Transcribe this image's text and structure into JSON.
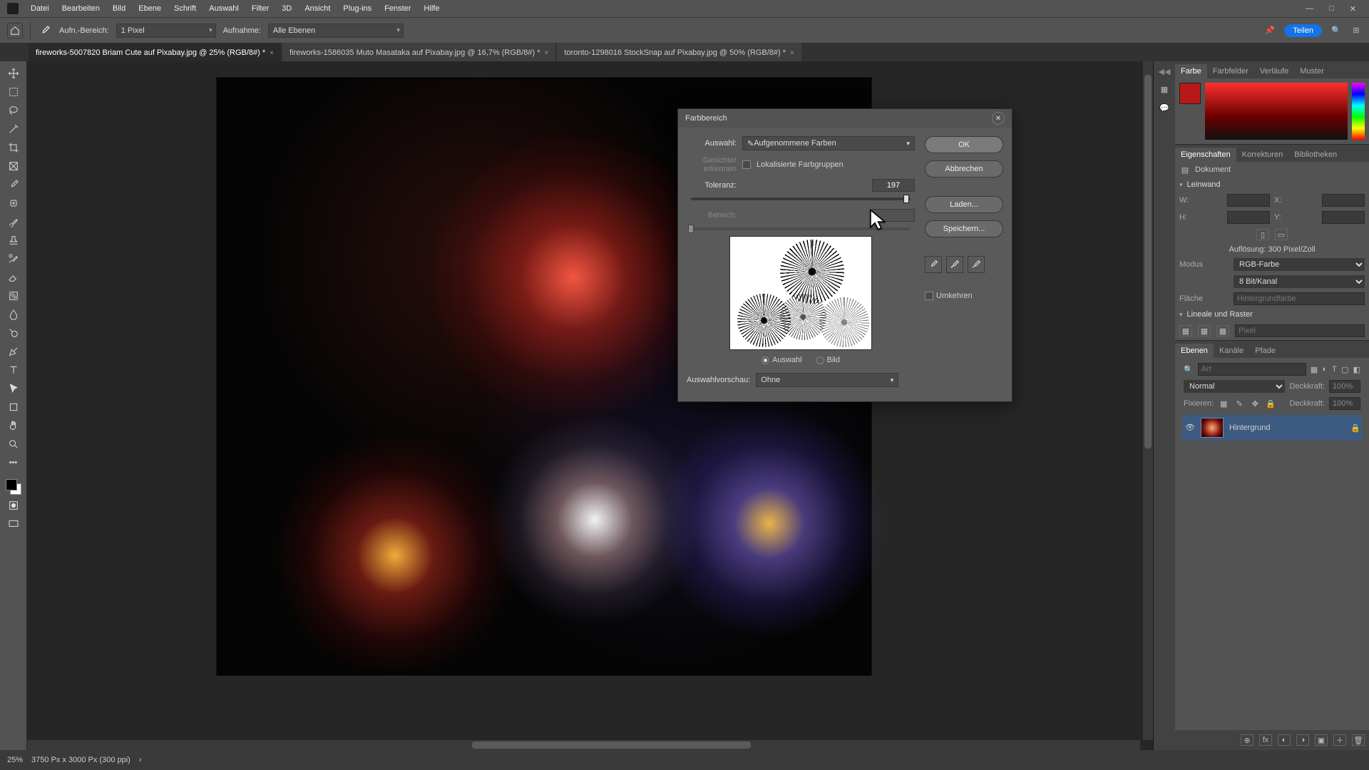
{
  "menu": {
    "items": [
      "Datei",
      "Bearbeiten",
      "Bild",
      "Ebene",
      "Schrift",
      "Auswahl",
      "Filter",
      "3D",
      "Ansicht",
      "Plug-ins",
      "Fenster",
      "Hilfe"
    ]
  },
  "optbar": {
    "size_label": "Aufn.-Bereich:",
    "size_value": "1 Pixel",
    "sample_label": "Aufnahme:",
    "sample_value": "Alle Ebenen",
    "share": "Teilen"
  },
  "tabs": [
    "fireworks-5007820 Briam Cute auf Pixabay.jpg @ 25% (RGB/8#) *",
    "fireworks-1586035 Muto Masataka auf Pixabay.jpg @ 16,7% (RGB/8#) *",
    "toronto-1298016 StockSnap auf Pixabay.jpg @ 50% (RGB/8#) *"
  ],
  "status": {
    "zoom": "25%",
    "dims": "3750 Px x 3000 Px (300 ppi)"
  },
  "panels": {
    "color_tabs": [
      "Farbe",
      "Farbfelder",
      "Verläufe",
      "Muster"
    ],
    "prop_tabs": [
      "Eigenschaften",
      "Korrekturen",
      "Bibliotheken"
    ],
    "doc": "Dokument",
    "canvas": "Leinwand",
    "w": "W:",
    "h": "H:",
    "x": "X:",
    "y": "Y:",
    "resolution": "Auflösung: 300 Pixel/Zoll",
    "mode_l": "Modus",
    "mode_v": "RGB-Farbe",
    "depth": "8 Bit/Kanal",
    "fill_l": "Fläche",
    "fill_v": "Hintergrundfarbe",
    "rulers": "Lineale und Raster",
    "layer_tabs": [
      "Ebenen",
      "Kanäle",
      "Pfade"
    ],
    "blend": "Normal",
    "opacity_l": "Deckkraft:",
    "opacity_v": "100%",
    "lock_l": "Fixieren:",
    "fill2_l": "Deckkraft:",
    "fill2_v": "100%",
    "layer_name": "Hintergrund",
    "search_ph": "Art"
  },
  "dialog": {
    "title": "Farbbereich",
    "select_l": "Auswahl:",
    "select_v": "Aufgenommene Farben",
    "faces": "Gesichter erkennen",
    "local": "Lokalisierte Farbgruppen",
    "tol_l": "Toleranz:",
    "tol_v": "197",
    "range_l": "Bereich:",
    "radio_sel": "Auswahl",
    "radio_img": "Bild",
    "preview_l": "Auswahlvorschau:",
    "preview_v": "Ohne",
    "ok": "OK",
    "cancel": "Abbrechen",
    "load": "Laden...",
    "save": "Speichern...",
    "invert": "Umkehren"
  }
}
